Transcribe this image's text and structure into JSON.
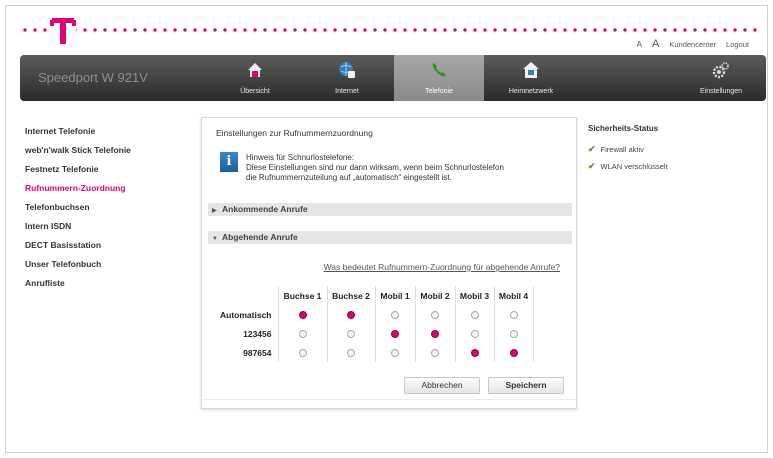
{
  "header": {
    "toplinks": {
      "a_small": "A",
      "a_large": "A",
      "kundencenter": "Kundencenter",
      "logout": "Logout"
    },
    "accent_color": "#e20074"
  },
  "navbar": {
    "brand": "Speedport W 921V",
    "items": [
      {
        "label": "Übersicht",
        "icon": "home-icon"
      },
      {
        "label": "Internet",
        "icon": "globe-icon"
      },
      {
        "label": "Telefonie",
        "icon": "phone-icon",
        "active": true
      },
      {
        "label": "Heimnetzwerk",
        "icon": "house-network-icon"
      },
      {
        "label": "Einstellungen",
        "icon": "gear-icon"
      }
    ]
  },
  "sidebar": {
    "items": [
      {
        "label": "Internet Telefonie"
      },
      {
        "label": "web'n'walk Stick Telefonie"
      },
      {
        "label": "Festnetz Telefonie"
      },
      {
        "label": "Rufnummern-Zuordnung",
        "active": true
      },
      {
        "label": "Telefonbuchsen"
      },
      {
        "label": "Intern ISDN"
      },
      {
        "label": "DECT Basisstation"
      },
      {
        "label": "Unser Telefonbuch"
      },
      {
        "label": "Anrufliste"
      }
    ]
  },
  "panel": {
    "title": "Einstellungen zur Rufnummernzuordnung",
    "info_line1": "Hinweis für Schnurlostelefone:",
    "info_line2": "Diese Einstellungen sind nur dann wirksam, wenn beim Schnurlostelefon",
    "info_line3": "die Rufnummernzuteilung auf „automatisch“ eingestellt ist.",
    "section_incoming": "Ankommende Anrufe",
    "section_outgoing": "Abgehende Anrufe",
    "help_link": "Was bedeutet Rufnummern-Zuordnung für abgehende Anrufe?",
    "columns": [
      "Buchse 1",
      "Buchse 2",
      "Mobil 1",
      "Mobil 2",
      "Mobil 3",
      "Mobil 4"
    ],
    "rows": [
      {
        "label": "Automatisch",
        "selected": [
          true,
          true,
          false,
          false,
          false,
          false
        ]
      },
      {
        "label": "123456",
        "selected": [
          false,
          false,
          true,
          true,
          false,
          false
        ]
      },
      {
        "label": "987654",
        "selected": [
          false,
          false,
          false,
          false,
          true,
          true
        ]
      }
    ],
    "cancel_label": "Abbrechen",
    "save_label": "Speichern"
  },
  "status": {
    "title": "Sicherheits-Status",
    "items": [
      "Firewall aktiv",
      "WLAN verschlüsselt"
    ]
  }
}
